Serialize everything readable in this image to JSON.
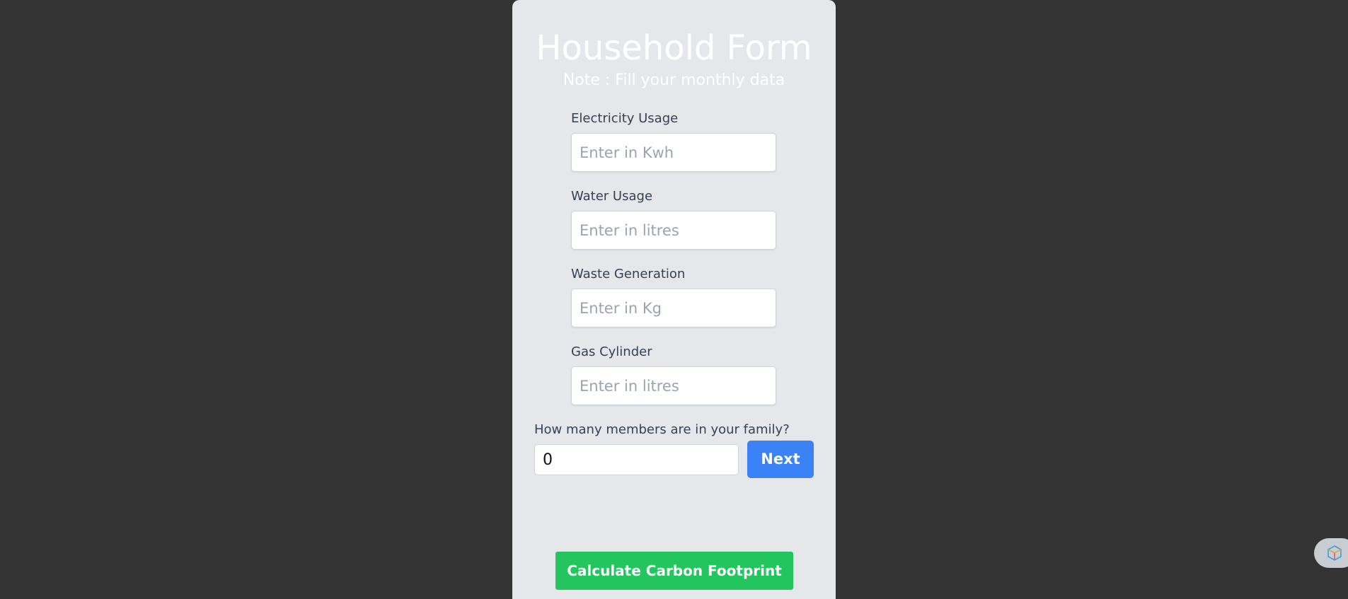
{
  "form": {
    "title": "Household Form",
    "note": "Note : Fill your monthly data",
    "fields": [
      {
        "label": "Electricity Usage",
        "placeholder": "Enter in Kwh",
        "value": ""
      },
      {
        "label": "Water Usage",
        "placeholder": "Enter in litres",
        "value": ""
      },
      {
        "label": "Waste Generation",
        "placeholder": "Enter in Kg",
        "value": ""
      },
      {
        "label": "Gas Cylinder",
        "placeholder": "Enter in litres",
        "value": ""
      }
    ],
    "family": {
      "label": "How many members are in your family?",
      "value": "0",
      "next_label": "Next"
    },
    "calculate_label": "Calculate Carbon Footprint"
  },
  "colors": {
    "page_background": "#333333",
    "card_background": "#e5e7eb",
    "next_button": "#3b82f6",
    "calculate_button": "#22c55e"
  },
  "icons": {
    "floating_widget": "extension-cube-icon"
  }
}
